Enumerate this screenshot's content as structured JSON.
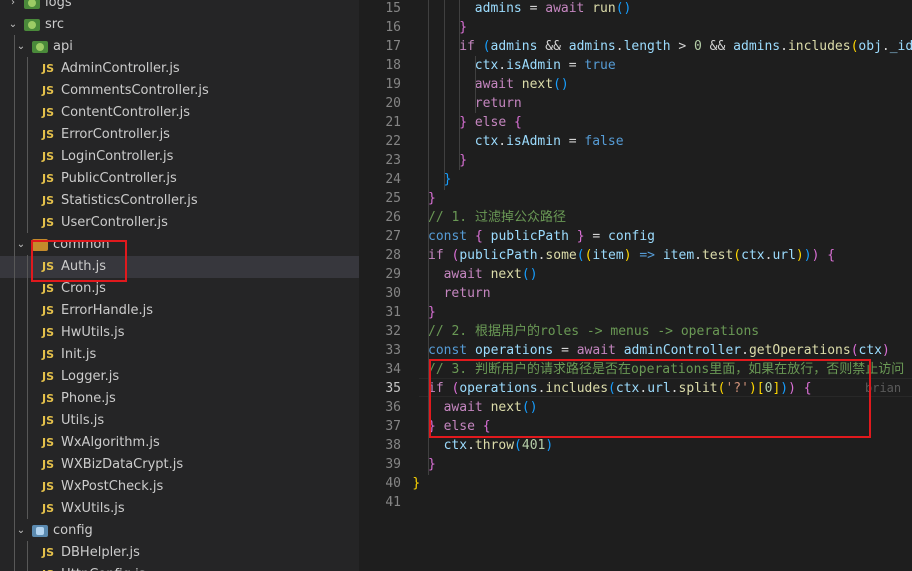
{
  "explorer": {
    "items": [
      {
        "label": "logs",
        "type": "folder",
        "icon": "logs-folder-icon",
        "chevron": "›",
        "indent": 0
      },
      {
        "label": "src",
        "type": "folder",
        "icon": "src-folder-icon",
        "chevron": "⌄",
        "indent": 0
      },
      {
        "label": "api",
        "type": "folder",
        "icon": "api-folder-icon",
        "chevron": "⌄",
        "indent": 1
      },
      {
        "label": "AdminController.js",
        "type": "file",
        "indent": 2
      },
      {
        "label": "CommentsController.js",
        "type": "file",
        "indent": 2
      },
      {
        "label": "ContentController.js",
        "type": "file",
        "indent": 2
      },
      {
        "label": "ErrorController.js",
        "type": "file",
        "indent": 2
      },
      {
        "label": "LoginController.js",
        "type": "file",
        "indent": 2
      },
      {
        "label": "PublicController.js",
        "type": "file",
        "indent": 2
      },
      {
        "label": "StatisticsController.js",
        "type": "file",
        "indent": 2
      },
      {
        "label": "UserController.js",
        "type": "file",
        "indent": 2
      },
      {
        "label": "common",
        "type": "folder",
        "icon": "common-folder-icon",
        "chevron": "⌄",
        "indent": 1
      },
      {
        "label": "Auth.js",
        "type": "file",
        "indent": 2,
        "selected": true
      },
      {
        "label": "Cron.js",
        "type": "file",
        "indent": 2
      },
      {
        "label": "ErrorHandle.js",
        "type": "file",
        "indent": 2
      },
      {
        "label": "HwUtils.js",
        "type": "file",
        "indent": 2
      },
      {
        "label": "Init.js",
        "type": "file",
        "indent": 2
      },
      {
        "label": "Logger.js",
        "type": "file",
        "indent": 2
      },
      {
        "label": "Phone.js",
        "type": "file",
        "indent": 2
      },
      {
        "label": "Utils.js",
        "type": "file",
        "indent": 2
      },
      {
        "label": "WxAlgorithm.js",
        "type": "file",
        "indent": 2
      },
      {
        "label": "WXBizDataCrypt.js",
        "type": "file",
        "indent": 2
      },
      {
        "label": "WxPostCheck.js",
        "type": "file",
        "indent": 2
      },
      {
        "label": "WxUtils.js",
        "type": "file",
        "indent": 2
      },
      {
        "label": "config",
        "type": "folder",
        "icon": "config-folder-icon",
        "chevron": "⌄",
        "indent": 1
      },
      {
        "label": "DBHelpler.js",
        "type": "file",
        "indent": 2
      },
      {
        "label": "HttpConfig.js",
        "type": "file",
        "indent": 2
      }
    ],
    "file_badge": "JS"
  },
  "editor": {
    "active_line": 35,
    "ghost_text": "brian",
    "lines": [
      {
        "num": "15",
        "indent": 6,
        "tokens": [
          [
            "v",
            "admins"
          ],
          [
            "w",
            " = "
          ],
          [
            "k",
            "await"
          ],
          [
            "w",
            " "
          ],
          [
            "f",
            "run"
          ],
          [
            "p",
            "()"
          ]
        ]
      },
      {
        "num": "16",
        "indent": 4,
        "tokens": [
          [
            "m",
            "}"
          ]
        ]
      },
      {
        "num": "17",
        "indent": 4,
        "tokens": [
          [
            "k",
            "if"
          ],
          [
            "w",
            " "
          ],
          [
            "p",
            "("
          ],
          [
            "v",
            "admins"
          ],
          [
            "w",
            " && "
          ],
          [
            "v",
            "admins"
          ],
          [
            "w",
            "."
          ],
          [
            "v",
            "length"
          ],
          [
            "w",
            " > "
          ],
          [
            "n",
            "0"
          ],
          [
            "w",
            " && "
          ],
          [
            "v",
            "admins"
          ],
          [
            "w",
            "."
          ],
          [
            "f",
            "includes"
          ],
          [
            "y",
            "("
          ],
          [
            "v",
            "obj"
          ],
          [
            "w",
            "."
          ],
          [
            "v",
            "_id"
          ],
          [
            "y",
            ")"
          ],
          [
            "p",
            ")"
          ],
          [
            "w",
            " "
          ],
          [
            "m",
            "{"
          ]
        ]
      },
      {
        "num": "18",
        "indent": 6,
        "tokens": [
          [
            "v",
            "ctx"
          ],
          [
            "w",
            "."
          ],
          [
            "v",
            "isAdmin"
          ],
          [
            "w",
            " = "
          ],
          [
            "b",
            "true"
          ]
        ]
      },
      {
        "num": "19",
        "indent": 6,
        "tokens": [
          [
            "k",
            "await"
          ],
          [
            "w",
            " "
          ],
          [
            "f",
            "next"
          ],
          [
            "p",
            "()"
          ]
        ]
      },
      {
        "num": "20",
        "indent": 6,
        "tokens": [
          [
            "k",
            "return"
          ]
        ]
      },
      {
        "num": "21",
        "indent": 4,
        "tokens": [
          [
            "m",
            "}"
          ],
          [
            "w",
            " "
          ],
          [
            "k",
            "else"
          ],
          [
            "w",
            " "
          ],
          [
            "m",
            "{"
          ]
        ]
      },
      {
        "num": "22",
        "indent": 6,
        "tokens": [
          [
            "v",
            "ctx"
          ],
          [
            "w",
            "."
          ],
          [
            "v",
            "isAdmin"
          ],
          [
            "w",
            " = "
          ],
          [
            "b",
            "false"
          ]
        ]
      },
      {
        "num": "23",
        "indent": 4,
        "tokens": [
          [
            "m",
            "}"
          ]
        ]
      },
      {
        "num": "24",
        "indent": 2,
        "tokens": [
          [
            "p",
            "}"
          ]
        ]
      },
      {
        "num": "25",
        "indent": 0,
        "tokens": [
          [
            "m",
            "}"
          ]
        ]
      },
      {
        "num": "26",
        "indent": 0,
        "tokens": [
          [
            "c",
            "// 1. 过滤掉公众路径"
          ]
        ]
      },
      {
        "num": "27",
        "indent": 0,
        "tokens": [
          [
            "b",
            "const"
          ],
          [
            "w",
            " "
          ],
          [
            "m",
            "{"
          ],
          [
            "w",
            " "
          ],
          [
            "v",
            "publicPath"
          ],
          [
            "w",
            " "
          ],
          [
            "m",
            "}"
          ],
          [
            "w",
            " = "
          ],
          [
            "v",
            "config"
          ]
        ]
      },
      {
        "num": "28",
        "indent": 0,
        "tokens": [
          [
            "k",
            "if"
          ],
          [
            "w",
            " "
          ],
          [
            "m",
            "("
          ],
          [
            "v",
            "publicPath"
          ],
          [
            "w",
            "."
          ],
          [
            "f",
            "some"
          ],
          [
            "p",
            "("
          ],
          [
            "y",
            "("
          ],
          [
            "v",
            "item"
          ],
          [
            "y",
            ")"
          ],
          [
            "w",
            " "
          ],
          [
            "b",
            "=>"
          ],
          [
            "w",
            " "
          ],
          [
            "v",
            "item"
          ],
          [
            "w",
            "."
          ],
          [
            "f",
            "test"
          ],
          [
            "y",
            "("
          ],
          [
            "v",
            "ctx"
          ],
          [
            "w",
            "."
          ],
          [
            "v",
            "url"
          ],
          [
            "y",
            ")"
          ],
          [
            "p",
            ")"
          ],
          [
            "m",
            ")"
          ],
          [
            "w",
            " "
          ],
          [
            "m",
            "{"
          ]
        ]
      },
      {
        "num": "29",
        "indent": 2,
        "tokens": [
          [
            "k",
            "await"
          ],
          [
            "w",
            " "
          ],
          [
            "f",
            "next"
          ],
          [
            "p",
            "()"
          ]
        ]
      },
      {
        "num": "30",
        "indent": 2,
        "tokens": [
          [
            "k",
            "return"
          ]
        ]
      },
      {
        "num": "31",
        "indent": 0,
        "tokens": [
          [
            "m",
            "}"
          ]
        ]
      },
      {
        "num": "32",
        "indent": 0,
        "tokens": [
          [
            "c",
            "// 2. 根据用户的roles -> menus -> operations"
          ]
        ]
      },
      {
        "num": "33",
        "indent": 0,
        "tokens": [
          [
            "b",
            "const"
          ],
          [
            "w",
            " "
          ],
          [
            "v",
            "operations"
          ],
          [
            "w",
            " = "
          ],
          [
            "k",
            "await"
          ],
          [
            "w",
            " "
          ],
          [
            "v",
            "adminController"
          ],
          [
            "w",
            "."
          ],
          [
            "f",
            "getOperations"
          ],
          [
            "m",
            "("
          ],
          [
            "v",
            "ctx"
          ],
          [
            "m",
            ")"
          ]
        ]
      },
      {
        "num": "34",
        "indent": 0,
        "tokens": [
          [
            "c",
            "// 3. 判断用户的请求路径是否在operations里面，如果在放行，否则禁止访问"
          ]
        ]
      },
      {
        "num": "35",
        "indent": 0,
        "tokens": [
          [
            "k",
            "if"
          ],
          [
            "w",
            " "
          ],
          [
            "m",
            "("
          ],
          [
            "v",
            "operations"
          ],
          [
            "w",
            "."
          ],
          [
            "f",
            "includes"
          ],
          [
            "p",
            "("
          ],
          [
            "v",
            "ctx"
          ],
          [
            "w",
            "."
          ],
          [
            "v",
            "url"
          ],
          [
            "w",
            "."
          ],
          [
            "f",
            "split"
          ],
          [
            "y",
            "("
          ],
          [
            "s",
            "'?'"
          ],
          [
            "y",
            ")"
          ],
          [
            "y",
            "["
          ],
          [
            "n",
            "0"
          ],
          [
            "y",
            "]"
          ],
          [
            "p",
            ")"
          ],
          [
            "m",
            ")"
          ],
          [
            "w",
            " "
          ],
          [
            "m",
            "{"
          ]
        ]
      },
      {
        "num": "36",
        "indent": 2,
        "tokens": [
          [
            "k",
            "await"
          ],
          [
            "w",
            " "
          ],
          [
            "f",
            "next"
          ],
          [
            "p",
            "()"
          ]
        ]
      },
      {
        "num": "37",
        "indent": 0,
        "tokens": [
          [
            "m",
            "}"
          ],
          [
            "w",
            " "
          ],
          [
            "k",
            "else"
          ],
          [
            "w",
            " "
          ],
          [
            "m",
            "{"
          ]
        ]
      },
      {
        "num": "38",
        "indent": 2,
        "tokens": [
          [
            "v",
            "ctx"
          ],
          [
            "w",
            "."
          ],
          [
            "f",
            "throw"
          ],
          [
            "p",
            "("
          ],
          [
            "n",
            "401"
          ],
          [
            "p",
            ")"
          ]
        ]
      },
      {
        "num": "39",
        "indent": 0,
        "tokens": [
          [
            "m",
            "}"
          ]
        ]
      },
      {
        "num": "40",
        "indent": -2,
        "tokens": [
          [
            "y",
            "}"
          ]
        ]
      },
      {
        "num": "41",
        "indent": -2,
        "tokens": []
      }
    ]
  }
}
